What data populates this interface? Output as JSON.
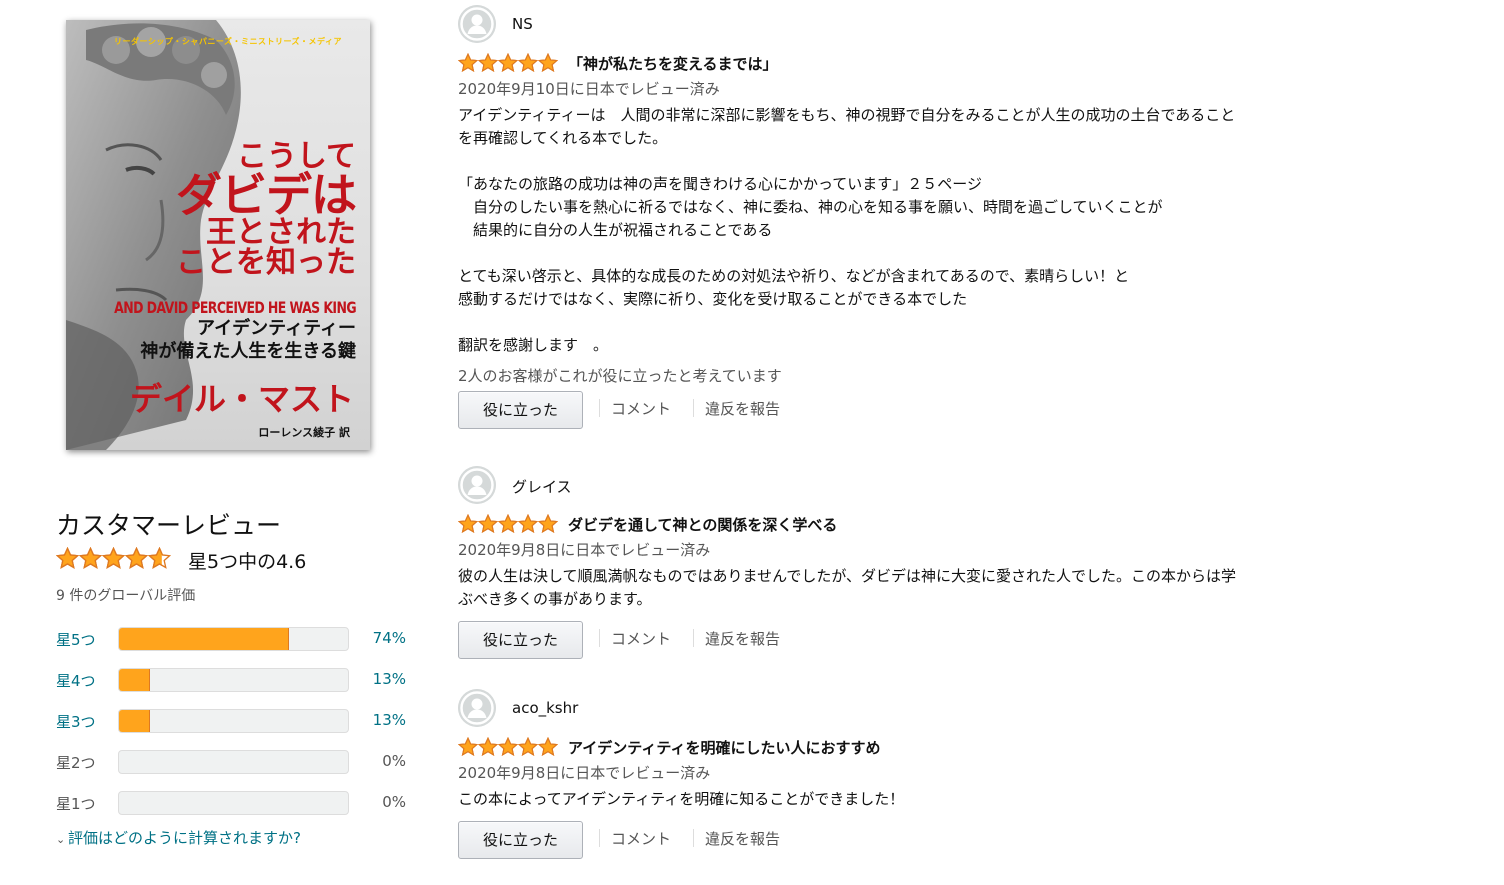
{
  "cover": {
    "series": "リーダーシップ・シャパニーズ・ミニストリーズ・メディア",
    "title_line1": "こうして",
    "title_line2": "ダビデは",
    "title_line3": "王とされた",
    "title_line4": "ことを知った",
    "title_en": "AND DAVID PERCEIVED HE WAS KING",
    "subtitle_line1": "アイデンティティー",
    "subtitle_line2": "神が備えた人生を生きる鍵",
    "author": "デイル・マスト",
    "translator": "ローレンス綾子 訳"
  },
  "summary": {
    "heading": "カスタマーレビュー",
    "out_of": "星5つ中の4.6",
    "rating": 4.6,
    "global_count": "9 件のグローバル評価",
    "histogram": [
      {
        "label": "星5つ",
        "pct_text": "74%",
        "fraction": 0.74,
        "link": true
      },
      {
        "label": "星4つ",
        "pct_text": "13%",
        "fraction": 0.13,
        "link": true
      },
      {
        "label": "星3つ",
        "pct_text": "13%",
        "fraction": 0.13,
        "link": true
      },
      {
        "label": "星2つ",
        "pct_text": "0%",
        "fraction": 0.0,
        "link": false
      },
      {
        "label": "星1つ",
        "pct_text": "0%",
        "fraction": 0.0,
        "link": false
      }
    ],
    "how_link": "評価はどのように計算されますか?"
  },
  "colors": {
    "star": "#ffa41c",
    "star_border": "#de7921",
    "link": "#007185",
    "cover_red": "#c1141c"
  },
  "reviews": [
    {
      "name": "NS",
      "rating": 5,
      "title": "「神が私たちを変えるまでは」",
      "date": "2020年9月10日に日本でレビュー済み",
      "body": [
        "アイデンティティーは　人間の非常に深部に影響をもち、神の視野で自分をみることが人生の成功の土台であること",
        "を再確認してくれる本でした。",
        "",
        "「あなたの旅路の成功は神の声を聞きわける心にかかっています」２５ページ",
        "　自分のしたい事を熱心に祈るではなく、神に委ね、神の心を知る事を願い、時間を過ごしていくことが",
        "　結果的に自分の人生が祝福されることである",
        "",
        "とても深い啓示と、具体的な成長のための対処法や祈り、などが含まれてあるので、素晴らしい！と",
        "感動するだけではなく、実際に祈り、変化を受け取ることができる本でした",
        "",
        "翻訳を感謝します　。"
      ],
      "helpful_count": "2人のお客様がこれが役に立ったと考えています",
      "helpful_button": "役に立った",
      "comment": "コメント",
      "report": "違反を報告"
    },
    {
      "name": "グレイス",
      "rating": 5,
      "title": "ダビデを通して神との関係を深く学べる",
      "date": "2020年9月8日に日本でレビュー済み",
      "body": [
        "彼の人生は決して順風満帆なものではありませんでしたが、ダビデは神に大変に愛された人でした。この本からは学",
        "ぶべき多くの事があります。"
      ],
      "helpful_count": "",
      "helpful_button": "役に立った",
      "comment": "コメント",
      "report": "違反を報告"
    },
    {
      "name": "aco_kshr",
      "rating": 5,
      "title": "アイデンティティを明確にしたい人におすすめ",
      "date": "2020年9月8日に日本でレビュー済み",
      "body": [
        "この本によってアイデンティティを明確に知ることができました！"
      ],
      "helpful_count": "",
      "helpful_button": "役に立った",
      "comment": "コメント",
      "report": "違反を報告"
    }
  ]
}
